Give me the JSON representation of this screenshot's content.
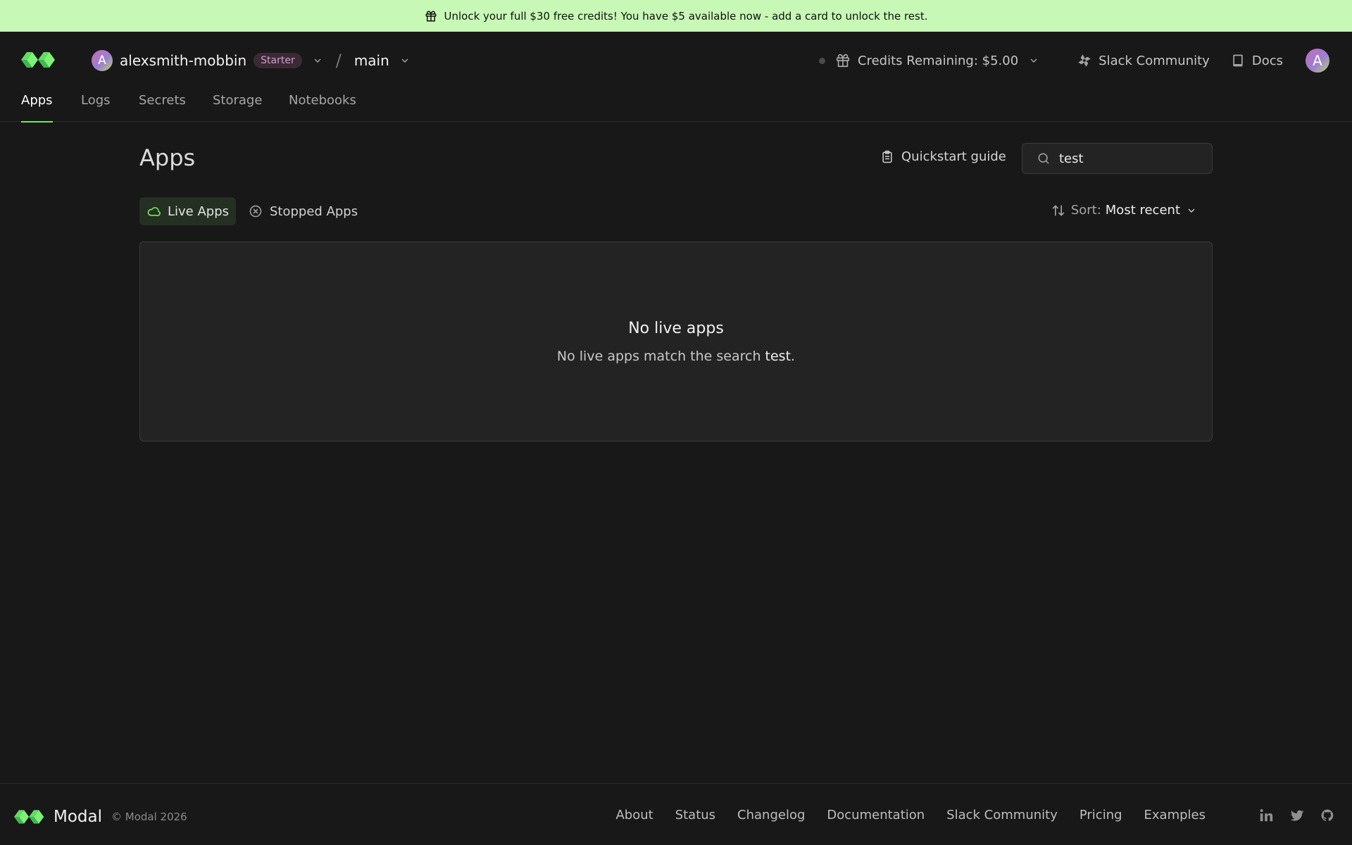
{
  "banner": {
    "text": "Unlock your full $30 free credits! You have $5 available now - add a card to unlock the rest.",
    "background": "#c7f8b5"
  },
  "header": {
    "workspace": {
      "avatar_letter": "A",
      "name": "alexsmith-mobbin",
      "plan_badge": "Starter"
    },
    "separator": "/",
    "environment": "main",
    "credits_label": "Credits Remaining: $5.00",
    "slack_label": "Slack Community",
    "docs_label": "Docs",
    "user_avatar_letter": "A"
  },
  "tabs": [
    {
      "label": "Apps",
      "active": true
    },
    {
      "label": "Logs",
      "active": false
    },
    {
      "label": "Secrets",
      "active": false
    },
    {
      "label": "Storage",
      "active": false
    },
    {
      "label": "Notebooks",
      "active": false
    }
  ],
  "main": {
    "title": "Apps",
    "quickstart_label": "Quickstart guide",
    "search": {
      "value": "test",
      "placeholder": ""
    },
    "filters": {
      "live_label": "Live Apps",
      "stopped_label": "Stopped Apps",
      "selected": "Live Apps"
    },
    "sort": {
      "label": "Sort:",
      "value": "Most recent"
    },
    "empty_state": {
      "title": "No live apps",
      "message_prefix": "No live apps match the search",
      "query": "test",
      "message_suffix": "."
    }
  },
  "footer": {
    "brand": "Modal",
    "copyright": "© Modal 2026",
    "links": [
      "About",
      "Status",
      "Changelog",
      "Documentation",
      "Slack Community",
      "Pricing",
      "Examples"
    ],
    "socials": [
      "linkedin-icon",
      "twitter-icon",
      "github-icon"
    ]
  },
  "colors": {
    "accent": "#7ce35f",
    "background": "#181818",
    "panel": "#232323",
    "badge_text": "#d79acb"
  }
}
